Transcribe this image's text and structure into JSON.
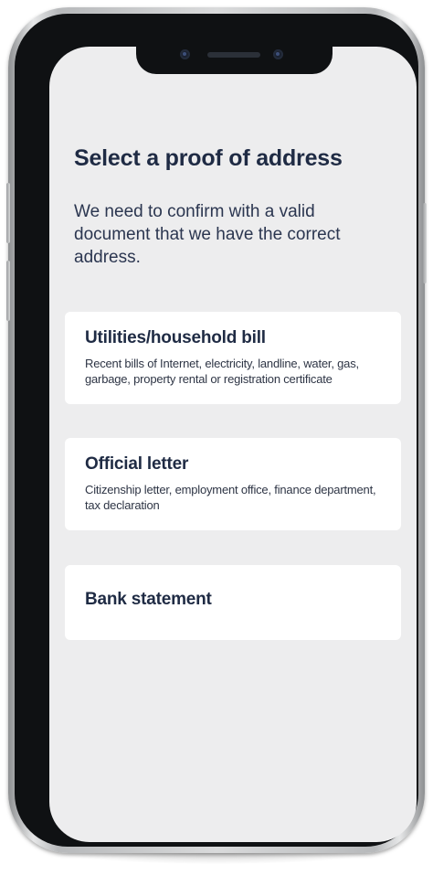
{
  "screen": {
    "title": "Select a proof of address",
    "subtitle": "We need to confirm with a valid document that we have the correct address."
  },
  "options": [
    {
      "title": "Utilities/household bill",
      "description": "Recent bills of Internet, electricity, landline, water, gas, garbage, property rental or registration certificate"
    },
    {
      "title": "Official letter",
      "description": "Citizenship letter, employment office, finance department, tax declaration"
    },
    {
      "title": "Bank statement"
    }
  ],
  "colors": {
    "screen_background": "#ededee",
    "card_background": "#ffffff",
    "text_primary": "#1f2b44",
    "bezel": "#0f1113"
  }
}
